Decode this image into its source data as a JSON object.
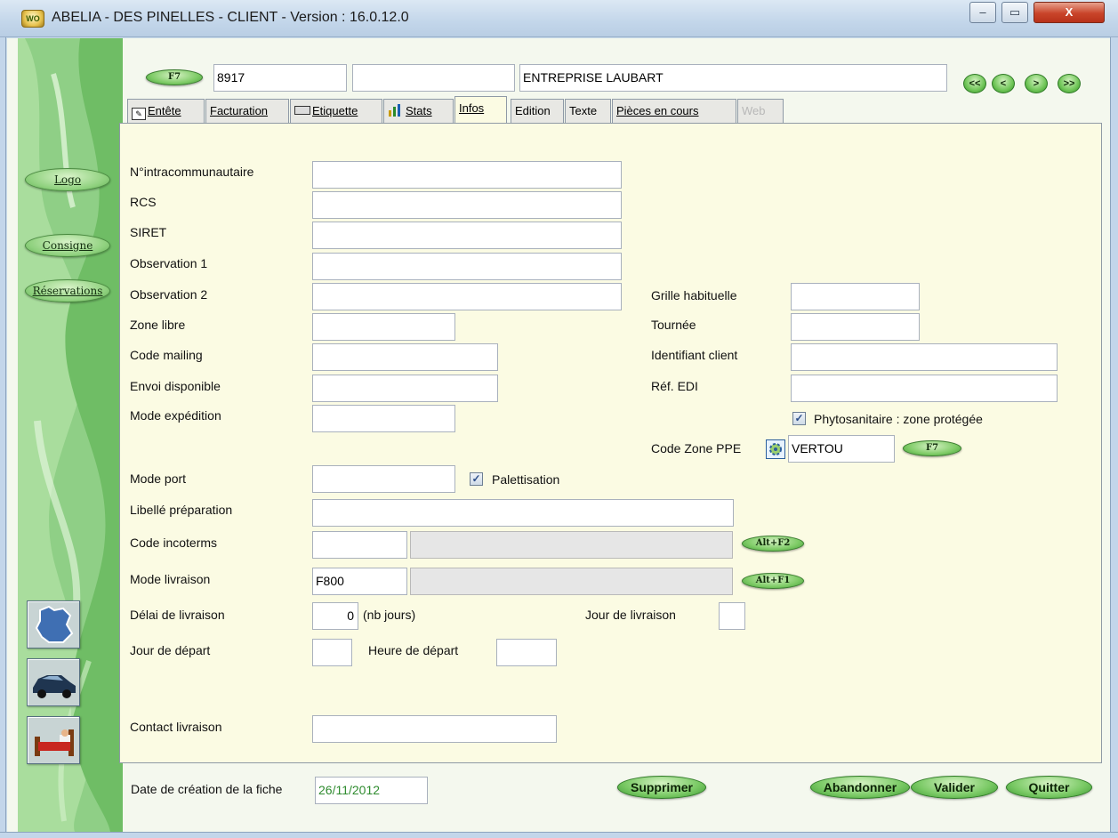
{
  "window": {
    "title": "ABELIA  -  DES PINELLES  -  CLIENT  -  Version : 16.0.12.0",
    "app_icon": "abelia-logo-icon",
    "minimize": "–",
    "maximize": "▭",
    "close": "X"
  },
  "header": {
    "f7_label": "F7",
    "client_code": "8917",
    "field2": "",
    "client_name": "ENTREPRISE LAUBART",
    "nav": [
      "<<",
      "<",
      ">",
      ">>"
    ]
  },
  "tabs": [
    {
      "label": "Entête",
      "icon": "header-edit-icon"
    },
    {
      "label": "Facturation"
    },
    {
      "label": "Etiquette",
      "icon": "label-icon"
    },
    {
      "label": "Stats",
      "icon": "bar-chart-icon"
    },
    {
      "label": "Infos",
      "active": true
    },
    {
      "label": "Edition"
    },
    {
      "label": "Texte"
    },
    {
      "label": "Pièces en cours"
    },
    {
      "label": "Web",
      "disabled": true
    }
  ],
  "sidebar": {
    "logo": "Logo",
    "consigne": "Consigne",
    "reservations": "Réservations",
    "buttons": [
      "france-map-icon",
      "car-icon",
      "bed-icon"
    ]
  },
  "form": {
    "intracom": {
      "label": "N°intracommunautaire",
      "value": ""
    },
    "rcs": {
      "label": "RCS",
      "value": ""
    },
    "siret": {
      "label": "SIRET",
      "value": ""
    },
    "obs1": {
      "label": "Observation 1",
      "value": ""
    },
    "obs2": {
      "label": "Observation 2",
      "value": ""
    },
    "zone_libre": {
      "label": "Zone libre",
      "value": ""
    },
    "code_mailing": {
      "label": "Code mailing",
      "value": ""
    },
    "envoi_dispo": {
      "label": "Envoi disponible",
      "value": ""
    },
    "mode_expedition": {
      "label": "Mode expédition",
      "value": ""
    },
    "grille": {
      "label": "Grille habituelle",
      "value": ""
    },
    "tournee": {
      "label": "Tournée",
      "value": ""
    },
    "identifiant": {
      "label": "Identifiant client",
      "value": ""
    },
    "ref_edi": {
      "label": "Réf. EDI",
      "value": ""
    },
    "phyto": {
      "label": "Phytosanitaire : zone protégée",
      "checked": true
    },
    "code_zone_ppe": {
      "label": "Code Zone PPE",
      "value": "VERTOU",
      "f7": "F7"
    },
    "mode_port": {
      "label": "Mode port",
      "value": ""
    },
    "palettisation": {
      "label": "Palettisation",
      "checked": true
    },
    "libelle_prep": {
      "label": "Libellé préparation",
      "value": ""
    },
    "incoterms": {
      "label": "Code incoterms",
      "code": "",
      "desc": "",
      "btn": "Alt+F2"
    },
    "mode_livraison": {
      "label": "Mode livraison",
      "code": "F800",
      "desc": "",
      "btn": "Alt+F1"
    },
    "delai": {
      "label": "Délai de livraison",
      "value": "0",
      "unit": "(nb jours)"
    },
    "jour_livraison": {
      "label": "Jour de livraison",
      "value": ""
    },
    "jour_depart": {
      "label": "Jour de départ",
      "value": ""
    },
    "heure_depart": {
      "label": "Heure de départ",
      "value": ""
    },
    "contact": {
      "label": "Contact livraison",
      "value": ""
    }
  },
  "footer": {
    "date_label": "Date de création de la fiche",
    "date_value": "26/11/2012",
    "supprimer": "Supprimer",
    "abandonner": "Abandonner",
    "valider": "Valider",
    "quitter": "Quitter"
  },
  "colors": {
    "panel_bg": "#fbfbe3",
    "accent_green": "#79c964",
    "date_text": "#2e8b2e"
  }
}
